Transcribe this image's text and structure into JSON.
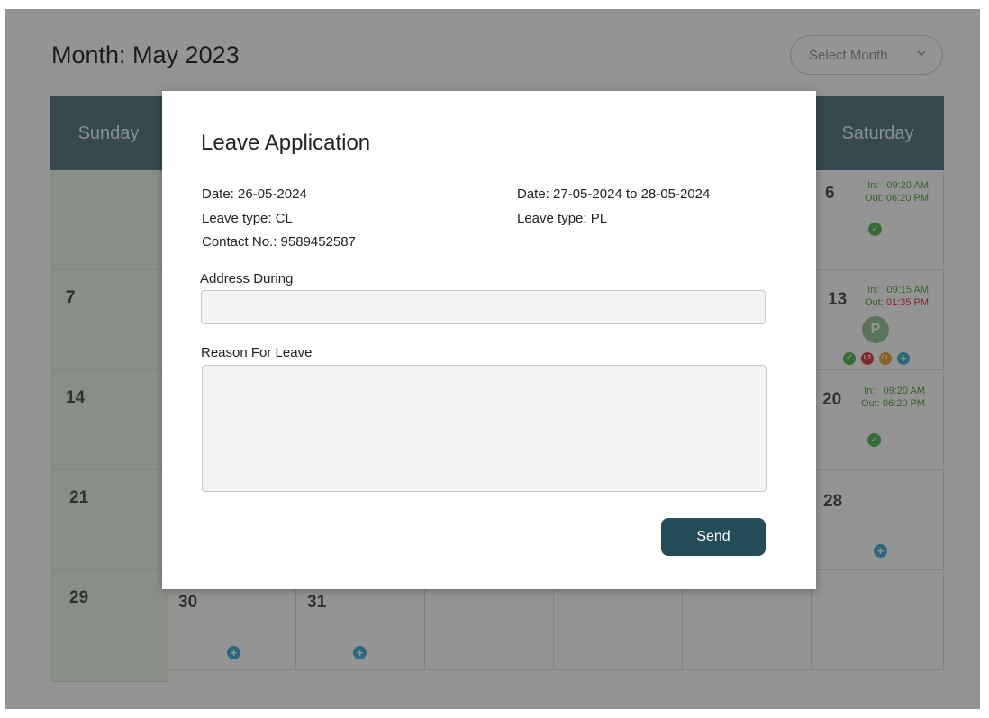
{
  "header": {
    "title": "Month: May 2023",
    "select_month_placeholder": "Select Month"
  },
  "calendar": {
    "day_names": [
      "Sunday",
      "Saturday"
    ],
    "dates": {
      "d6": "6",
      "d7": "7",
      "d13": "13",
      "d14": "14",
      "d20": "20",
      "d21": "21",
      "d28": "28",
      "d29": "29",
      "d30": "30",
      "d31": "31"
    },
    "attendance": {
      "d6": {
        "in_label": "In:",
        "in_time": "09:20 AM",
        "out_label": "Out:",
        "out_time": "06:20 PM"
      },
      "d13": {
        "in_label": "In:",
        "in_time": "09:15 AM",
        "out_label": "Out:",
        "out_time": "01:35 PM",
        "badge": "P",
        "leave_badges": [
          "L2",
          "CL"
        ]
      },
      "d20": {
        "in_label": "In:",
        "in_time": "09:20 AM",
        "out_label": "Out:",
        "out_time": "06:20 PM"
      }
    },
    "colors": {
      "header_bg": "#5d7f87",
      "sunday_bg": "#ecf6e9",
      "present": "#5fb85f",
      "add": "#4cb6d6",
      "late": "#e04848"
    }
  },
  "modal": {
    "title": "Leave Application",
    "left": {
      "date": "Date: 26-05-2024",
      "leave_type": "Leave type: CL",
      "contact": "Contact No.: 9589452587"
    },
    "right": {
      "date": "Date: 27-05-2024 to 28-05-2024",
      "leave_type": "Leave type: PL"
    },
    "address_label": "Address During",
    "address_value": "",
    "reason_label": "Reason For Leave",
    "reason_value": "",
    "send_label": "Send",
    "colors": {
      "send_bg": "#244d57"
    }
  }
}
